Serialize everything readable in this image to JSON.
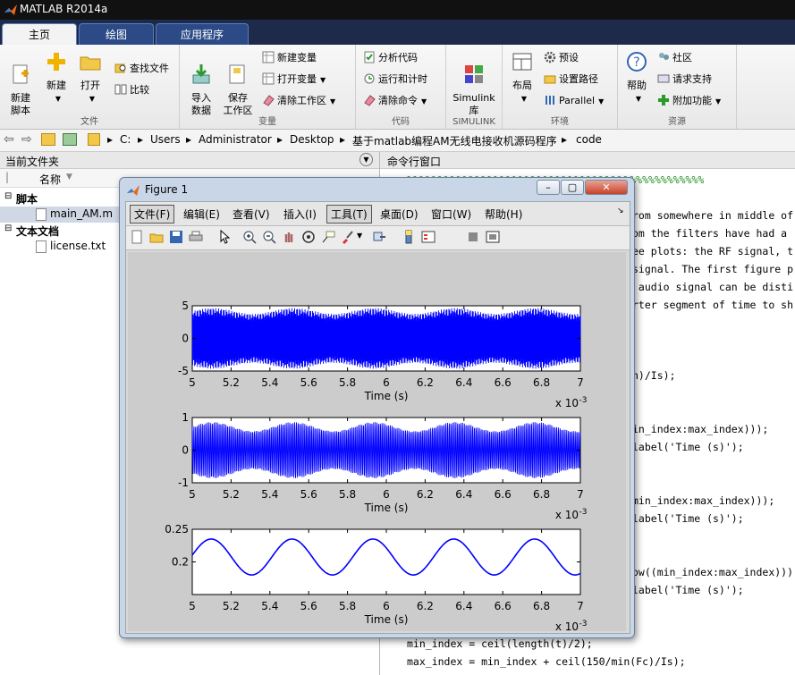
{
  "window": {
    "title": "MATLAB R2014a"
  },
  "ribbon_tabs": [
    {
      "label": "主页"
    },
    {
      "label": "绘图"
    },
    {
      "label": "应用程序"
    }
  ],
  "ribbon": {
    "file": {
      "caption": "文件",
      "new_script": "新建\n脚本",
      "new": "新建",
      "open": "打开",
      "find_files": "查找文件",
      "compare": "比较"
    },
    "variable": {
      "caption": "变量",
      "import_data": "导入\n数据",
      "save_workspace": "保存\n工作区",
      "new_variable": "新建变量",
      "open_variable": "打开变量",
      "clear_workspace": "清除工作区"
    },
    "code": {
      "caption": "代码",
      "analyze_code": "分析代码",
      "run_and_time": "运行和计时",
      "clear_commands": "清除命令"
    },
    "simulink": {
      "caption": "SIMULINK",
      "label": "Simulink\n库"
    },
    "environment": {
      "caption": "环境",
      "layout": "布局",
      "preferences": "预设",
      "set_path": "设置路径",
      "parallel": "Parallel"
    },
    "resources": {
      "caption": "资源",
      "help": "帮助",
      "community": "社区",
      "request_support": "请求支持",
      "add_ons": "附加功能"
    }
  },
  "address": {
    "path": [
      "C:",
      "Users",
      "Administrator",
      "Desktop",
      "基于matlab编程AM无线电接收机源码程序",
      "code"
    ]
  },
  "current_folder": {
    "title": "当前文件夹",
    "name_column": "名称",
    "groups": [
      {
        "label": "脚本",
        "files": [
          "main_AM.m"
        ]
      },
      {
        "label": "文本文档",
        "files": [
          "license.txt"
        ]
      }
    ]
  },
  "command_window": {
    "title": "命令行窗口",
    "lines": [
      "%%%%%%%%%%%%%%%%%%%%%%%%%%%%%%%%%%%%%%%%%%%%%%%%",
      "rom somewhere in middle of",
      "om the filters have had a",
      "ee plots: the RF signal, t",
      "signal. The first figure p",
      " audio signal can be disti",
      "rter segment of time to sh",
      "n)/Is);",
      "in_index:max_index)));",
      "label('Time (s)');",
      "min_index:max_index)));",
      "label('Time (s)');",
      "ow((min_index:max_index)))",
      "label('Time (s)');",
      "min_index = ceil(length(t)/2);",
      "max_index = min_index + ceil(150/min(Fc)/Is);"
    ]
  },
  "figure": {
    "title": "Figure 1",
    "menu": [
      "文件(F)",
      "编辑(E)",
      "查看(V)",
      "插入(I)",
      "工具(T)",
      "桌面(D)",
      "窗口(W)",
      "帮助(H)"
    ],
    "toolbar_icons": [
      "new-figure-icon",
      "open-file-icon",
      "save-icon",
      "print-icon",
      "pointer-icon",
      "zoom-in-icon",
      "zoom-out-icon",
      "pan-icon",
      "rotate-3d-icon",
      "data-cursor-icon",
      "brush-icon",
      "link-plot-icon",
      "colorbar-icon",
      "legend-icon",
      "hide-plot-tools-icon",
      "show-plot-tools-icon"
    ]
  },
  "chart_data": [
    {
      "type": "line",
      "xlabel": "Time (s)",
      "xlim": [
        0.005,
        0.007
      ],
      "ylim": [
        -5,
        5
      ],
      "x_ticks": [
        "5",
        "5.2",
        "5.4",
        "5.6",
        "5.8",
        "6",
        "6.2",
        "6.4",
        "6.6",
        "6.8",
        "7"
      ],
      "x_exponent": "x 10",
      "x_exponent_power": "-3",
      "y_ticks": [
        "5",
        "0",
        "-5"
      ],
      "signal": "RF modulated carrier, amplitude ~4.2 with envelope ripple",
      "color": "#0000ff"
    },
    {
      "type": "line",
      "xlabel": "Time (s)",
      "xlim": [
        0.005,
        0.007
      ],
      "ylim": [
        -1,
        1
      ],
      "x_ticks": [
        "5",
        "5.2",
        "5.4",
        "5.6",
        "5.8",
        "6",
        "6.2",
        "6.4",
        "6.6",
        "6.8",
        "7"
      ],
      "x_exponent": "x 10",
      "x_exponent_power": "-3",
      "y_ticks": [
        "1",
        "0",
        "-1"
      ],
      "signal": "IF signal, amplitude oscillating between ~0.6 and ~0.85",
      "color": "#0000ff"
    },
    {
      "type": "line",
      "xlabel": "Time (s)",
      "xlim": [
        0.005,
        0.007
      ],
      "ylim": [
        0.15,
        0.25
      ],
      "x_ticks": [
        "5",
        "5.2",
        "5.4",
        "5.6",
        "5.8",
        "6",
        "6.2",
        "6.4",
        "6.6",
        "6.8",
        "7"
      ],
      "x_exponent": "x 10",
      "x_exponent_power": "-3",
      "y_ticks": [
        "0.25",
        "0.2"
      ],
      "signal": "Demodulated audio: sinusoid, mean 0.2075, amplitude 0.0275, period 0.000417 s",
      "color": "#0000ff"
    }
  ]
}
